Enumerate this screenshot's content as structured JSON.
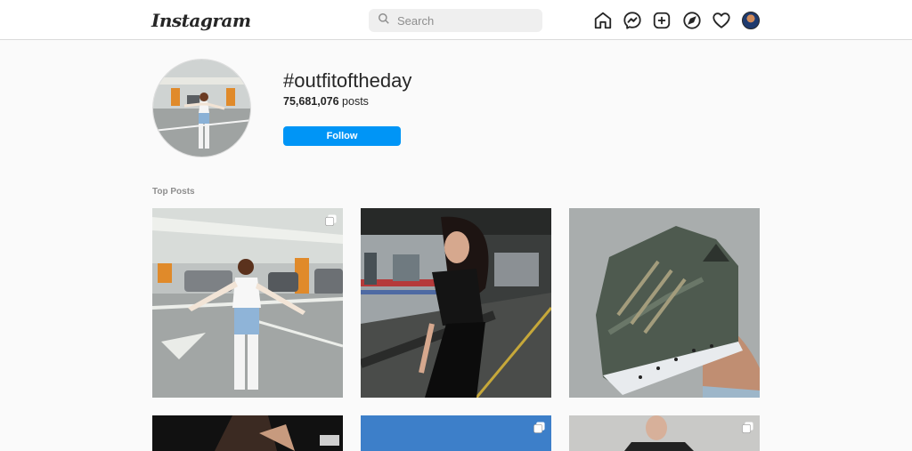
{
  "header": {
    "logo_text": "Instagram",
    "search_placeholder": "Search",
    "nav_icons": [
      "home-icon",
      "messenger-icon",
      "new-post-icon",
      "explore-icon",
      "activity-heart-icon",
      "profile-avatar"
    ]
  },
  "tag": {
    "name": "#outfitoftheday",
    "post_count": "75,681,076",
    "post_suffix": "posts",
    "follow_label": "Follow"
  },
  "section": {
    "title": "Top Posts"
  },
  "colors": {
    "accent": "#0095f6",
    "border": "#dbdbdb",
    "background": "#fafafa"
  },
  "posts": [
    {
      "alt": "woman posing in parking garage",
      "multi": true
    },
    {
      "alt": "woman in black outfit near train",
      "multi": false
    },
    {
      "alt": "green sneaker held in hand",
      "multi": false
    },
    {
      "alt": "dark post",
      "multi": false
    },
    {
      "alt": "blue sky post",
      "multi": true
    },
    {
      "alt": "man in jacket",
      "multi": true
    }
  ]
}
